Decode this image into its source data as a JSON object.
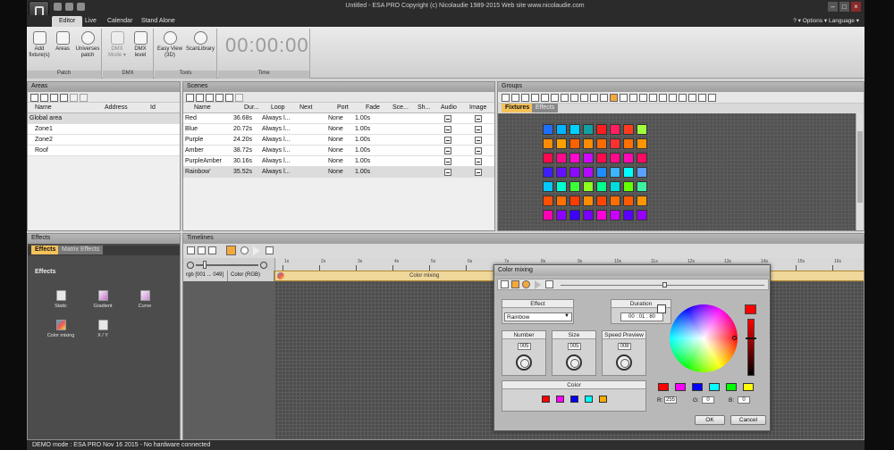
{
  "window": {
    "title": "Untitled - ESA PRO   Copyright (c) Nicolaudie 1989-2015   Web site www.nicolaudie.com",
    "minimize": "–",
    "maximize": "□",
    "close": "×"
  },
  "ribbon_tabs": [
    "Editor",
    "Live",
    "Calendar",
    "Stand Alone"
  ],
  "options_bar": "? ▾ Options ▾ Language ▾",
  "ribbon": {
    "patch": {
      "label": "Patch",
      "buttons": [
        {
          "label": "Add\nfixture(s)"
        },
        {
          "label": "Areas"
        },
        {
          "label": "Universes\npatch"
        }
      ]
    },
    "dmx": {
      "label": "DMX",
      "buttons": [
        {
          "label": "DMX\nMode ▾"
        },
        {
          "label": "DMX\nlevel"
        }
      ]
    },
    "tools": {
      "label": "Tools",
      "buttons": [
        {
          "label": "Easy View\n(3D)"
        },
        {
          "label": "ScanLibrary"
        }
      ]
    },
    "time": {
      "label": "Time",
      "value": "00:00:00"
    }
  },
  "areas": {
    "title": "Areas",
    "columns": [
      "Name",
      "Address",
      "Id"
    ],
    "rows": [
      {
        "name": "Global area",
        "indent": 0
      },
      {
        "name": "Zone1",
        "indent": 1
      },
      {
        "name": "Zone2",
        "indent": 1
      },
      {
        "name": "Roof",
        "indent": 1
      }
    ]
  },
  "scenes": {
    "title": "Scenes",
    "columns": [
      "Name",
      "Dur...",
      "Loop",
      "Next",
      "Port",
      "Fade",
      "Sce...",
      "Sh...",
      "Audio",
      "Image"
    ],
    "rows": [
      {
        "name": "Red",
        "duration": "36.68s",
        "loop": "Always l...",
        "port": "None",
        "fade": "1.00s"
      },
      {
        "name": "Blue",
        "duration": "20.72s",
        "loop": "Always l...",
        "port": "None",
        "fade": "1.00s"
      },
      {
        "name": "Purple",
        "duration": "24.20s",
        "loop": "Always l...",
        "port": "None",
        "fade": "1.00s"
      },
      {
        "name": "Amber",
        "duration": "38.72s",
        "loop": "Always l...",
        "port": "None",
        "fade": "1.00s"
      },
      {
        "name": "PurpleAmber",
        "duration": "30.16s",
        "loop": "Always l...",
        "port": "None",
        "fade": "1.00s"
      },
      {
        "name": "Rainbow'",
        "duration": "35.52s",
        "loop": "Always l...",
        "port": "None",
        "fade": "1.00s"
      }
    ]
  },
  "groups": {
    "title": "Groups",
    "tabs": [
      "Fixtures",
      "Effects"
    ],
    "grid": [
      [
        "#1e6fff",
        "#00b4ff",
        "#00d2ff",
        "#10a0a0",
        "#ff1e1e",
        "#ff1e60",
        "#ff3c1e",
        "#a0ff3c"
      ],
      [
        "#ff8c00",
        "#ffa000",
        "#ff6000",
        "#ff8c00",
        "#ff6a00",
        "#ff3030",
        "#ff7000",
        "#ff9600"
      ],
      [
        "#ff0a50",
        "#ff0a8c",
        "#ff0acc",
        "#cc0aff",
        "#ff0a50",
        "#ff0a8c",
        "#ff0ab4",
        "#ff0a64"
      ],
      [
        "#3c1eff",
        "#6410ff",
        "#8c0aff",
        "#b40aff",
        "#1e8cff",
        "#3cb4ff",
        "#00ffff",
        "#5aa0ff"
      ],
      [
        "#00c8ff",
        "#00ffd2",
        "#3cff3c",
        "#8cff1e",
        "#00ff8c",
        "#00dcdc",
        "#64ff00",
        "#3cf0a0"
      ],
      [
        "#ff5000",
        "#ff7000",
        "#ff3c00",
        "#ff8c00",
        "#ff4600",
        "#ff6e00",
        "#ff5a00",
        "#ff9600"
      ],
      [
        "#ff00b4",
        "#8c00ff",
        "#3c00ff",
        "#7800ff",
        "#ff00dc",
        "#c800ff",
        "#5a00ff",
        "#9600ff"
      ]
    ]
  },
  "effects": {
    "title": "Effects",
    "tabs": [
      "Effects",
      "Matrix Effects"
    ],
    "section": "Effects",
    "items": [
      {
        "label": "Static"
      },
      {
        "label": "Gradient"
      },
      {
        "label": "Curve"
      },
      {
        "label": "Color mixing"
      },
      {
        "label": "X / Y"
      }
    ]
  },
  "timelines": {
    "title": "Timelines",
    "track_name": "rgb [001 ... 049]",
    "track_param": "Color (RGB)",
    "clip_label": "Color mixing",
    "ruler_marks": [
      "1s",
      "2s",
      "3s",
      "4s",
      "5s",
      "6s",
      "7s",
      "8s",
      "9s",
      "10s",
      "11s",
      "12s",
      "13s",
      "14s",
      "15s",
      "16s"
    ]
  },
  "dialog": {
    "title": "Color mixing",
    "effect": {
      "label": "Effect",
      "value": "Rainbow"
    },
    "duration": {
      "label": "Duration",
      "value": "00 : 01 : 80"
    },
    "number": {
      "label": "Number",
      "value": "005"
    },
    "size": {
      "label": "Size",
      "value": "005"
    },
    "speed_preview": {
      "label": "Speed Preview",
      "value": "008"
    },
    "color": {
      "label": "Color",
      "swatches": [
        "#ff0000",
        "#ff00ff",
        "#0000ff",
        "#00ffff",
        "#ffaa00"
      ]
    },
    "palette": [
      "#ff0000",
      "#ff00ff",
      "#0000ff",
      "#00ffff",
      "#00ff00",
      "#ffff00"
    ],
    "rgb": {
      "r_label": "R:",
      "r": "255",
      "g_label": "G:",
      "g": "0",
      "b_label": "B:",
      "b": "0"
    },
    "ok": "OK",
    "cancel": "Cancel"
  },
  "status": "DEMO mode : ESA PRO Nov 16 2015 - No hardware connected"
}
